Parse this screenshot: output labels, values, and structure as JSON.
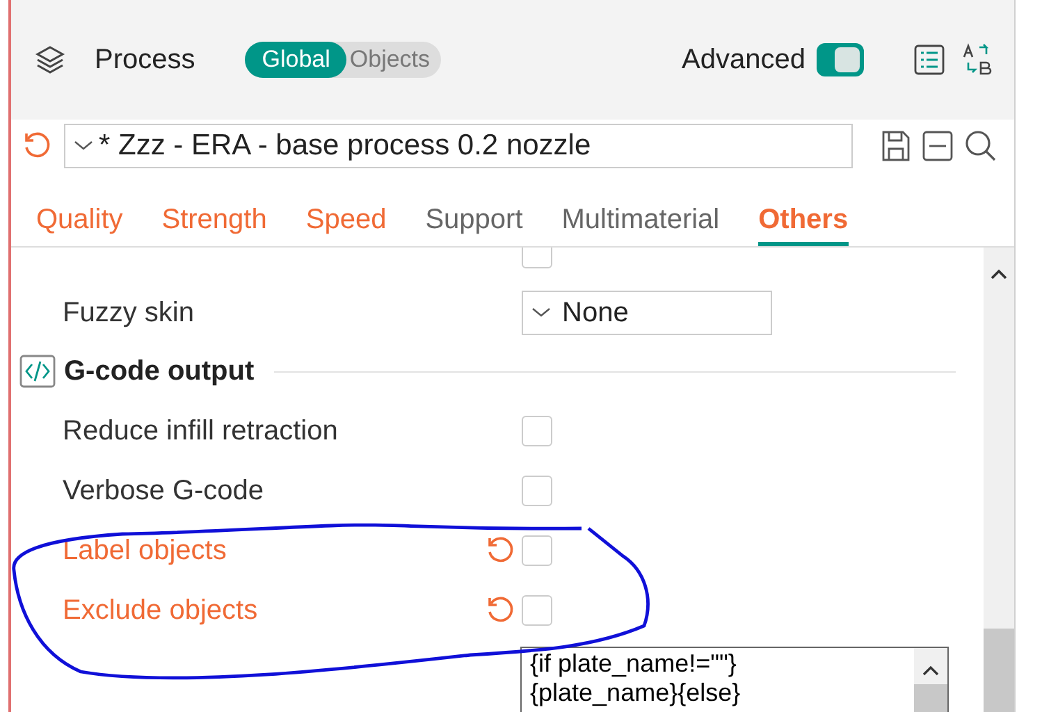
{
  "header": {
    "title": "Process",
    "scope": [
      {
        "label": "Global",
        "selected": true
      },
      {
        "label": "Objects",
        "selected": false
      }
    ],
    "advanced": {
      "label": "Advanced",
      "on": true
    }
  },
  "preset": {
    "modified": true,
    "name": "* Zzz - ERA - base process 0.2 nozzle"
  },
  "tabs": [
    {
      "label": "Quality",
      "modified": true,
      "selected": false
    },
    {
      "label": "Strength",
      "modified": true,
      "selected": false
    },
    {
      "label": "Speed",
      "modified": true,
      "selected": false
    },
    {
      "label": "Support",
      "modified": false,
      "selected": false
    },
    {
      "label": "Multimaterial",
      "modified": false,
      "selected": false
    },
    {
      "label": "Others",
      "modified": true,
      "selected": true
    }
  ],
  "settings": [
    {
      "kind": "checkbox",
      "checked": false
    },
    {
      "kind": "select",
      "label": "Fuzzy skin",
      "value": "None",
      "modified": false
    },
    {
      "kind": "section",
      "label": "G-code output"
    },
    {
      "kind": "checkbox",
      "label": "Reduce infill retraction",
      "checked": false,
      "modified": false
    },
    {
      "kind": "checkbox",
      "label": "Verbose G-code",
      "checked": false,
      "modified": false
    },
    {
      "kind": "checkbox",
      "label": "Label objects",
      "checked": false,
      "modified": true
    },
    {
      "kind": "checkbox",
      "label": "Exclude objects",
      "checked": false,
      "modified": true
    },
    {
      "kind": "code",
      "lines": [
        "{if plate_name!=\"\"}",
        "{plate_name}{else}"
      ]
    }
  ]
}
